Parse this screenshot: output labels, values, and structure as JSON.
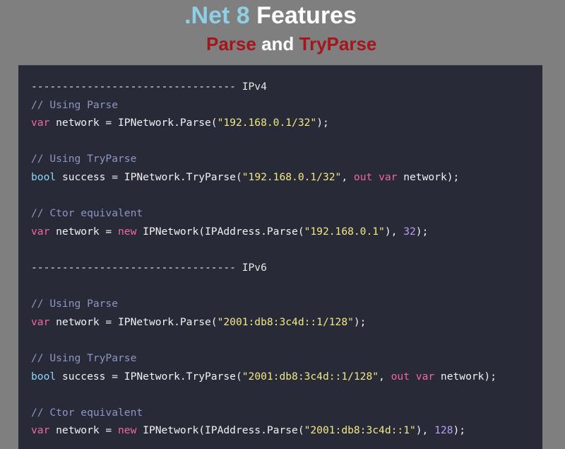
{
  "header": {
    "title_accent": ".Net 8",
    "title_rest": " Features",
    "subtitle_parse": "Parse",
    "subtitle_and": " and ",
    "subtitle_tryparse": "TryParse"
  },
  "code": {
    "ipv4_separator": "--------------------------------- IPv4",
    "ipv4_parse_comment": "// Using Parse",
    "ipv4_parse": {
      "kw": "var",
      "pre": " network = IPNetwork.Parse(",
      "str": "\"192.168.0.1/32\"",
      "post": ");"
    },
    "ipv4_tryparse_comment": "// Using TryParse",
    "ipv4_tryparse": {
      "type": "bool",
      "pre": " success = IPNetwork.TryParse(",
      "str": "\"192.168.0.1/32\"",
      "mid": ", ",
      "kw_out": "out",
      "sp": " ",
      "kw_var": "var",
      "post": " network);"
    },
    "ipv4_ctor_comment": "// Ctor equivalent",
    "ipv4_ctor": {
      "kw": "var",
      "pre1": " network = ",
      "kw_new": "new",
      "pre2": " IPNetwork(IPAddress.Parse(",
      "str": "\"192.168.0.1\"",
      "mid": "), ",
      "num": "32",
      "post": ");"
    },
    "ipv6_separator": "--------------------------------- IPv6",
    "ipv6_parse_comment": "// Using Parse",
    "ipv6_parse": {
      "kw": "var",
      "pre": " network = IPNetwork.Parse(",
      "str": "\"2001:db8:3c4d::1/128\"",
      "post": ");"
    },
    "ipv6_tryparse_comment": "// Using TryParse",
    "ipv6_tryparse": {
      "type": "bool",
      "pre": " success = IPNetwork.TryParse(",
      "str": "\"2001:db8:3c4d::1/128\"",
      "mid": ", ",
      "kw_out": "out",
      "sp": " ",
      "kw_var": "var",
      "post": " network);"
    },
    "ipv6_ctor_comment": "// Ctor equivalent",
    "ipv6_ctor": {
      "kw": "var",
      "pre1": " network = ",
      "kw_new": "new",
      "pre2": " IPNetwork(IPAddress.Parse(",
      "str": "\"2001:db8:3c4d::1\"",
      "mid": "), ",
      "num": "128",
      "post": ");"
    }
  }
}
